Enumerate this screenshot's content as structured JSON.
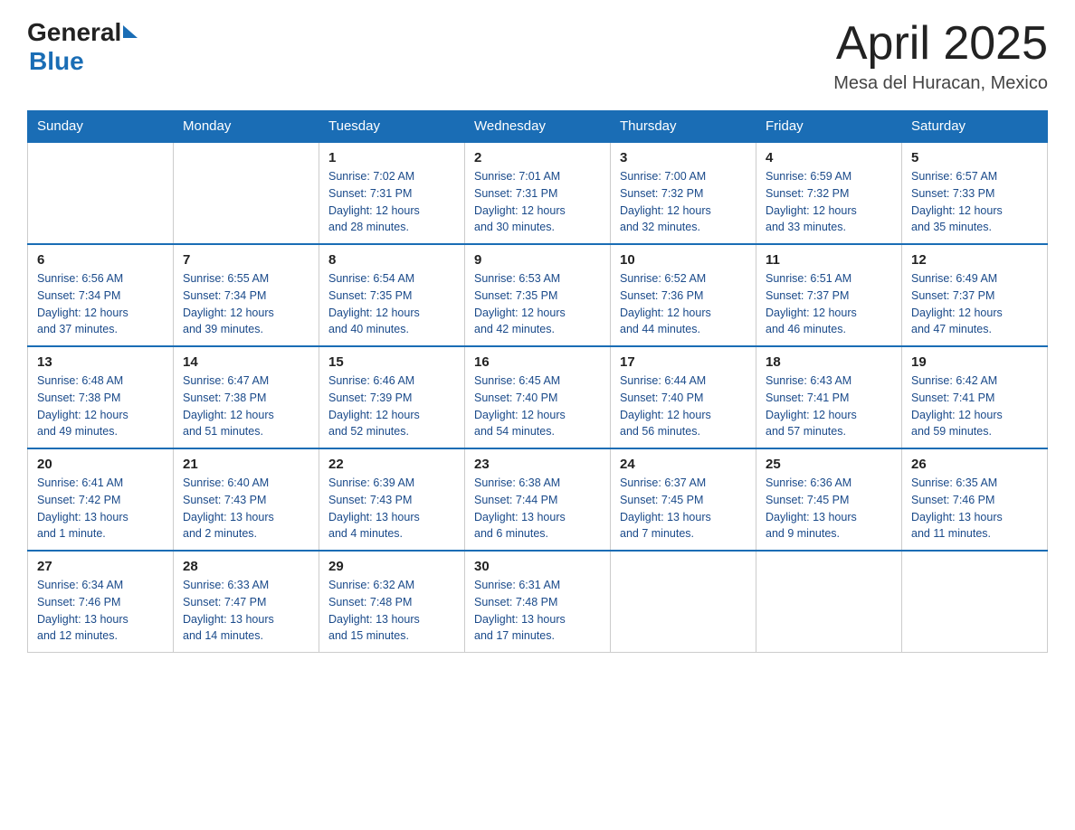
{
  "header": {
    "logo_general": "General",
    "logo_blue": "Blue",
    "month_title": "April 2025",
    "location": "Mesa del Huracan, Mexico"
  },
  "days_of_week": [
    "Sunday",
    "Monday",
    "Tuesday",
    "Wednesday",
    "Thursday",
    "Friday",
    "Saturday"
  ],
  "weeks": [
    [
      {
        "day": "",
        "info": ""
      },
      {
        "day": "",
        "info": ""
      },
      {
        "day": "1",
        "info": "Sunrise: 7:02 AM\nSunset: 7:31 PM\nDaylight: 12 hours\nand 28 minutes."
      },
      {
        "day": "2",
        "info": "Sunrise: 7:01 AM\nSunset: 7:31 PM\nDaylight: 12 hours\nand 30 minutes."
      },
      {
        "day": "3",
        "info": "Sunrise: 7:00 AM\nSunset: 7:32 PM\nDaylight: 12 hours\nand 32 minutes."
      },
      {
        "day": "4",
        "info": "Sunrise: 6:59 AM\nSunset: 7:32 PM\nDaylight: 12 hours\nand 33 minutes."
      },
      {
        "day": "5",
        "info": "Sunrise: 6:57 AM\nSunset: 7:33 PM\nDaylight: 12 hours\nand 35 minutes."
      }
    ],
    [
      {
        "day": "6",
        "info": "Sunrise: 6:56 AM\nSunset: 7:34 PM\nDaylight: 12 hours\nand 37 minutes."
      },
      {
        "day": "7",
        "info": "Sunrise: 6:55 AM\nSunset: 7:34 PM\nDaylight: 12 hours\nand 39 minutes."
      },
      {
        "day": "8",
        "info": "Sunrise: 6:54 AM\nSunset: 7:35 PM\nDaylight: 12 hours\nand 40 minutes."
      },
      {
        "day": "9",
        "info": "Sunrise: 6:53 AM\nSunset: 7:35 PM\nDaylight: 12 hours\nand 42 minutes."
      },
      {
        "day": "10",
        "info": "Sunrise: 6:52 AM\nSunset: 7:36 PM\nDaylight: 12 hours\nand 44 minutes."
      },
      {
        "day": "11",
        "info": "Sunrise: 6:51 AM\nSunset: 7:37 PM\nDaylight: 12 hours\nand 46 minutes."
      },
      {
        "day": "12",
        "info": "Sunrise: 6:49 AM\nSunset: 7:37 PM\nDaylight: 12 hours\nand 47 minutes."
      }
    ],
    [
      {
        "day": "13",
        "info": "Sunrise: 6:48 AM\nSunset: 7:38 PM\nDaylight: 12 hours\nand 49 minutes."
      },
      {
        "day": "14",
        "info": "Sunrise: 6:47 AM\nSunset: 7:38 PM\nDaylight: 12 hours\nand 51 minutes."
      },
      {
        "day": "15",
        "info": "Sunrise: 6:46 AM\nSunset: 7:39 PM\nDaylight: 12 hours\nand 52 minutes."
      },
      {
        "day": "16",
        "info": "Sunrise: 6:45 AM\nSunset: 7:40 PM\nDaylight: 12 hours\nand 54 minutes."
      },
      {
        "day": "17",
        "info": "Sunrise: 6:44 AM\nSunset: 7:40 PM\nDaylight: 12 hours\nand 56 minutes."
      },
      {
        "day": "18",
        "info": "Sunrise: 6:43 AM\nSunset: 7:41 PM\nDaylight: 12 hours\nand 57 minutes."
      },
      {
        "day": "19",
        "info": "Sunrise: 6:42 AM\nSunset: 7:41 PM\nDaylight: 12 hours\nand 59 minutes."
      }
    ],
    [
      {
        "day": "20",
        "info": "Sunrise: 6:41 AM\nSunset: 7:42 PM\nDaylight: 13 hours\nand 1 minute."
      },
      {
        "day": "21",
        "info": "Sunrise: 6:40 AM\nSunset: 7:43 PM\nDaylight: 13 hours\nand 2 minutes."
      },
      {
        "day": "22",
        "info": "Sunrise: 6:39 AM\nSunset: 7:43 PM\nDaylight: 13 hours\nand 4 minutes."
      },
      {
        "day": "23",
        "info": "Sunrise: 6:38 AM\nSunset: 7:44 PM\nDaylight: 13 hours\nand 6 minutes."
      },
      {
        "day": "24",
        "info": "Sunrise: 6:37 AM\nSunset: 7:45 PM\nDaylight: 13 hours\nand 7 minutes."
      },
      {
        "day": "25",
        "info": "Sunrise: 6:36 AM\nSunset: 7:45 PM\nDaylight: 13 hours\nand 9 minutes."
      },
      {
        "day": "26",
        "info": "Sunrise: 6:35 AM\nSunset: 7:46 PM\nDaylight: 13 hours\nand 11 minutes."
      }
    ],
    [
      {
        "day": "27",
        "info": "Sunrise: 6:34 AM\nSunset: 7:46 PM\nDaylight: 13 hours\nand 12 minutes."
      },
      {
        "day": "28",
        "info": "Sunrise: 6:33 AM\nSunset: 7:47 PM\nDaylight: 13 hours\nand 14 minutes."
      },
      {
        "day": "29",
        "info": "Sunrise: 6:32 AM\nSunset: 7:48 PM\nDaylight: 13 hours\nand 15 minutes."
      },
      {
        "day": "30",
        "info": "Sunrise: 6:31 AM\nSunset: 7:48 PM\nDaylight: 13 hours\nand 17 minutes."
      },
      {
        "day": "",
        "info": ""
      },
      {
        "day": "",
        "info": ""
      },
      {
        "day": "",
        "info": ""
      }
    ]
  ]
}
